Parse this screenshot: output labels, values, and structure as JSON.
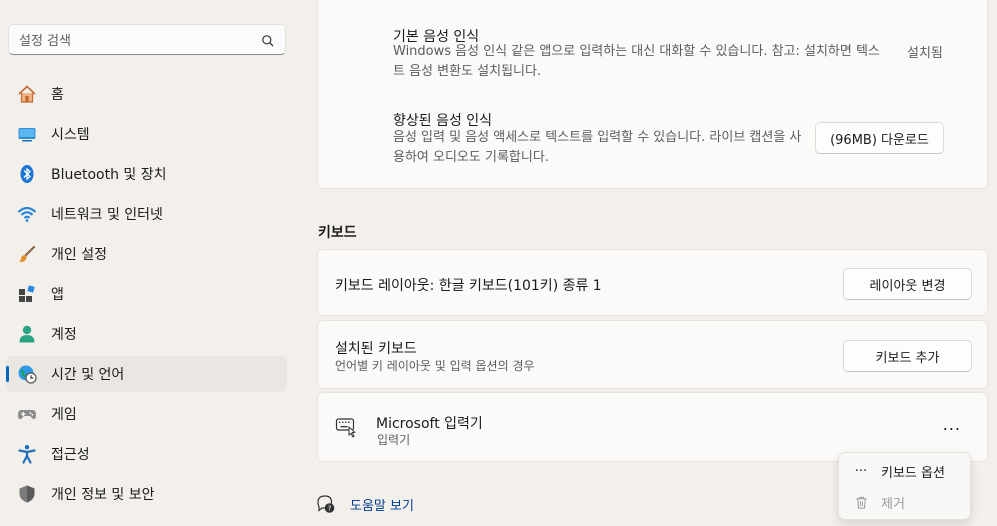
{
  "search": {
    "placeholder": "설정 검색"
  },
  "nav": [
    {
      "label": "홈",
      "icon": "home-icon"
    },
    {
      "label": "시스템",
      "icon": "system-icon"
    },
    {
      "label": "Bluetooth 및 장치",
      "icon": "bluetooth-icon"
    },
    {
      "label": "네트워크 및 인터넷",
      "icon": "wifi-icon"
    },
    {
      "label": "개인 설정",
      "icon": "brush-icon"
    },
    {
      "label": "앱",
      "icon": "apps-icon"
    },
    {
      "label": "계정",
      "icon": "account-icon"
    },
    {
      "label": "시간 및 언어",
      "icon": "globe-clock-icon",
      "active": true
    },
    {
      "label": "게임",
      "icon": "gamepad-icon"
    },
    {
      "label": "접근성",
      "icon": "accessibility-icon"
    },
    {
      "label": "개인 정보 및 보안",
      "icon": "shield-icon"
    }
  ],
  "speech": {
    "basic_title": "기본 음성 인식",
    "basic_desc": "Windows 음성 인식 같은 앱으로 입력하는 대신 대화할 수 있습니다. 참고: 설치하면 텍스트 음성 변환도 설치됩니다.",
    "basic_status": "설치됨",
    "enhanced_title": "향상된 음성 인식",
    "enhanced_desc": "음성 입력 및 음성 액세스로 텍스트를 입력할 수 있습니다. 라이브 캡션을 사용하여 오디오도 기록합니다.",
    "download_label": "(96MB) 다운로드"
  },
  "keyboard": {
    "section_title": "키보드",
    "layout_label": "키보드 레이아웃: 한글 키보드(101키) 종류 1",
    "layout_button": "레이아웃 변경",
    "installed_title": "설치된 키보드",
    "installed_sub": "언어별 키 레이아웃 및 입력 옵션의 경우",
    "add_button": "키보드 추가",
    "ime_title": "Microsoft 입력기",
    "ime_sub": "입력기",
    "more_label": "..."
  },
  "menu": {
    "options_label": "키보드 옵션",
    "options_icon": "···",
    "remove_label": "제거"
  },
  "help": {
    "label": "도움말 보기"
  },
  "colors": {
    "accent": "#0067c0",
    "link": "#003e92",
    "background": "#f3f0ec",
    "card": "#fbfaf8"
  }
}
